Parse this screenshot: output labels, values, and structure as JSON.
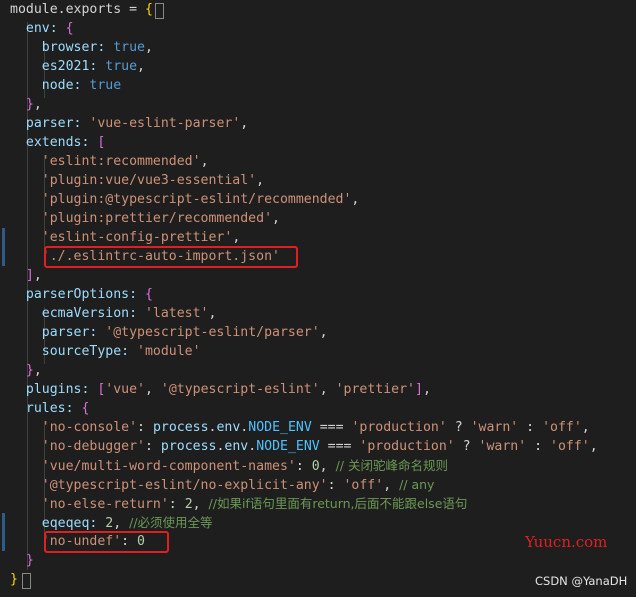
{
  "code_lines": [
    [
      [
        "module",
        "plain"
      ],
      [
        ".",
        "plain"
      ],
      [
        "exports",
        "plain"
      ],
      [
        " = ",
        "plain"
      ],
      [
        "{",
        "brace"
      ]
    ],
    [
      [
        "  env: ",
        "prop"
      ],
      [
        "{",
        "brace2"
      ]
    ],
    [
      [
        "    browser: ",
        "prop"
      ],
      [
        "true",
        "kw"
      ],
      [
        ",",
        "plain"
      ]
    ],
    [
      [
        "    es2021: ",
        "prop"
      ],
      [
        "true",
        "kw"
      ],
      [
        ",",
        "plain"
      ]
    ],
    [
      [
        "    node: ",
        "prop"
      ],
      [
        "true",
        "kw"
      ]
    ],
    [
      [
        "  ",
        "plain"
      ],
      [
        "}",
        "brace2"
      ],
      [
        ",",
        "plain"
      ]
    ],
    [
      [
        "  parser: ",
        "prop"
      ],
      [
        "'vue-eslint-parser'",
        "str"
      ],
      [
        ",",
        "plain"
      ]
    ],
    [
      [
        "  extends: ",
        "prop"
      ],
      [
        "[",
        "brace2"
      ]
    ],
    [
      [
        "    'eslint:recommended'",
        "str"
      ],
      [
        ",",
        "plain"
      ]
    ],
    [
      [
        "    'plugin:vue/vue3-essential'",
        "str"
      ],
      [
        ",",
        "plain"
      ]
    ],
    [
      [
        "    'plugin:@typescript-eslint/recommended'",
        "str"
      ],
      [
        ",",
        "plain"
      ]
    ],
    [
      [
        "    'plugin:prettier/recommended'",
        "str"
      ],
      [
        ",",
        "plain"
      ]
    ],
    [
      [
        "    'eslint-config-prettier'",
        "str"
      ],
      [
        ",",
        "plain"
      ]
    ],
    [
      [
        "    './.eslintrc-auto-import.json'",
        "str"
      ]
    ],
    [
      [
        "  ",
        "plain"
      ],
      [
        "]",
        "brace2"
      ],
      [
        ",",
        "plain"
      ]
    ],
    [
      [
        "  parserOptions: ",
        "prop"
      ],
      [
        "{",
        "brace2"
      ]
    ],
    [
      [
        "    ecmaVersion: ",
        "prop"
      ],
      [
        "'latest'",
        "str"
      ],
      [
        ",",
        "plain"
      ]
    ],
    [
      [
        "    parser: ",
        "prop"
      ],
      [
        "'@typescript-eslint/parser'",
        "str"
      ],
      [
        ",",
        "plain"
      ]
    ],
    [
      [
        "    sourceType: ",
        "prop"
      ],
      [
        "'module'",
        "str"
      ]
    ],
    [
      [
        "  ",
        "plain"
      ],
      [
        "}",
        "brace2"
      ],
      [
        ",",
        "plain"
      ]
    ],
    [
      [
        "  plugins: ",
        "prop"
      ],
      [
        "[",
        "brace2"
      ],
      [
        "'vue'",
        "str"
      ],
      [
        ", ",
        "plain"
      ],
      [
        "'@typescript-eslint'",
        "str"
      ],
      [
        ", ",
        "plain"
      ],
      [
        "'prettier'",
        "str"
      ],
      [
        "]",
        "brace2"
      ],
      [
        ",",
        "plain"
      ]
    ],
    [
      [
        "  rules: ",
        "prop"
      ],
      [
        "{",
        "brace2"
      ]
    ],
    [
      [
        "    'no-console'",
        "str"
      ],
      [
        ": ",
        "plain"
      ],
      [
        "process",
        "var"
      ],
      [
        ".",
        "plain"
      ],
      [
        "env",
        "var"
      ],
      [
        ".",
        "plain"
      ],
      [
        "NODE_ENV",
        "const"
      ],
      [
        " === ",
        "plain"
      ],
      [
        "'production'",
        "str"
      ],
      [
        " ? ",
        "plain"
      ],
      [
        "'warn'",
        "str"
      ],
      [
        " : ",
        "plain"
      ],
      [
        "'off'",
        "str"
      ],
      [
        ",",
        "plain"
      ]
    ],
    [
      [
        "    'no-debugger'",
        "str"
      ],
      [
        ": ",
        "plain"
      ],
      [
        "process",
        "var"
      ],
      [
        ".",
        "plain"
      ],
      [
        "env",
        "var"
      ],
      [
        ".",
        "plain"
      ],
      [
        "NODE_ENV",
        "const"
      ],
      [
        " === ",
        "plain"
      ],
      [
        "'production'",
        "str"
      ],
      [
        " ? ",
        "plain"
      ],
      [
        "'warn'",
        "str"
      ],
      [
        " : ",
        "plain"
      ],
      [
        "'off'",
        "str"
      ],
      [
        ",",
        "plain"
      ]
    ],
    [
      [
        "    'vue/multi-word-component-names'",
        "str"
      ],
      [
        ": ",
        "plain"
      ],
      [
        "0",
        "num"
      ],
      [
        ", ",
        "plain"
      ],
      [
        "// 关闭驼峰命名规则",
        "com"
      ]
    ],
    [
      [
        "    '@typescript-eslint/no-explicit-any'",
        "str"
      ],
      [
        ": ",
        "plain"
      ],
      [
        "'off'",
        "str"
      ],
      [
        ", ",
        "plain"
      ],
      [
        "// any",
        "com"
      ]
    ],
    [
      [
        "    'no-else-return'",
        "str"
      ],
      [
        ": ",
        "plain"
      ],
      [
        "2",
        "num"
      ],
      [
        ", ",
        "plain"
      ],
      [
        "//如果if语句里面有return,后面不能跟else语句",
        "com"
      ]
    ],
    [
      [
        "    eqeqeq: ",
        "prop"
      ],
      [
        "2",
        "num"
      ],
      [
        ", ",
        "plain"
      ],
      [
        "//必须使用全等",
        "com"
      ]
    ],
    [
      [
        "    'no-undef'",
        "str"
      ],
      [
        ": ",
        "plain"
      ],
      [
        "0",
        "num"
      ]
    ],
    [
      [
        "  ",
        "plain"
      ],
      [
        "}",
        "brace2"
      ]
    ],
    [
      [
        "}",
        "brace"
      ]
    ]
  ],
  "watermark": "Yuucn.com",
  "attribution": "CSDN @YanaDH"
}
